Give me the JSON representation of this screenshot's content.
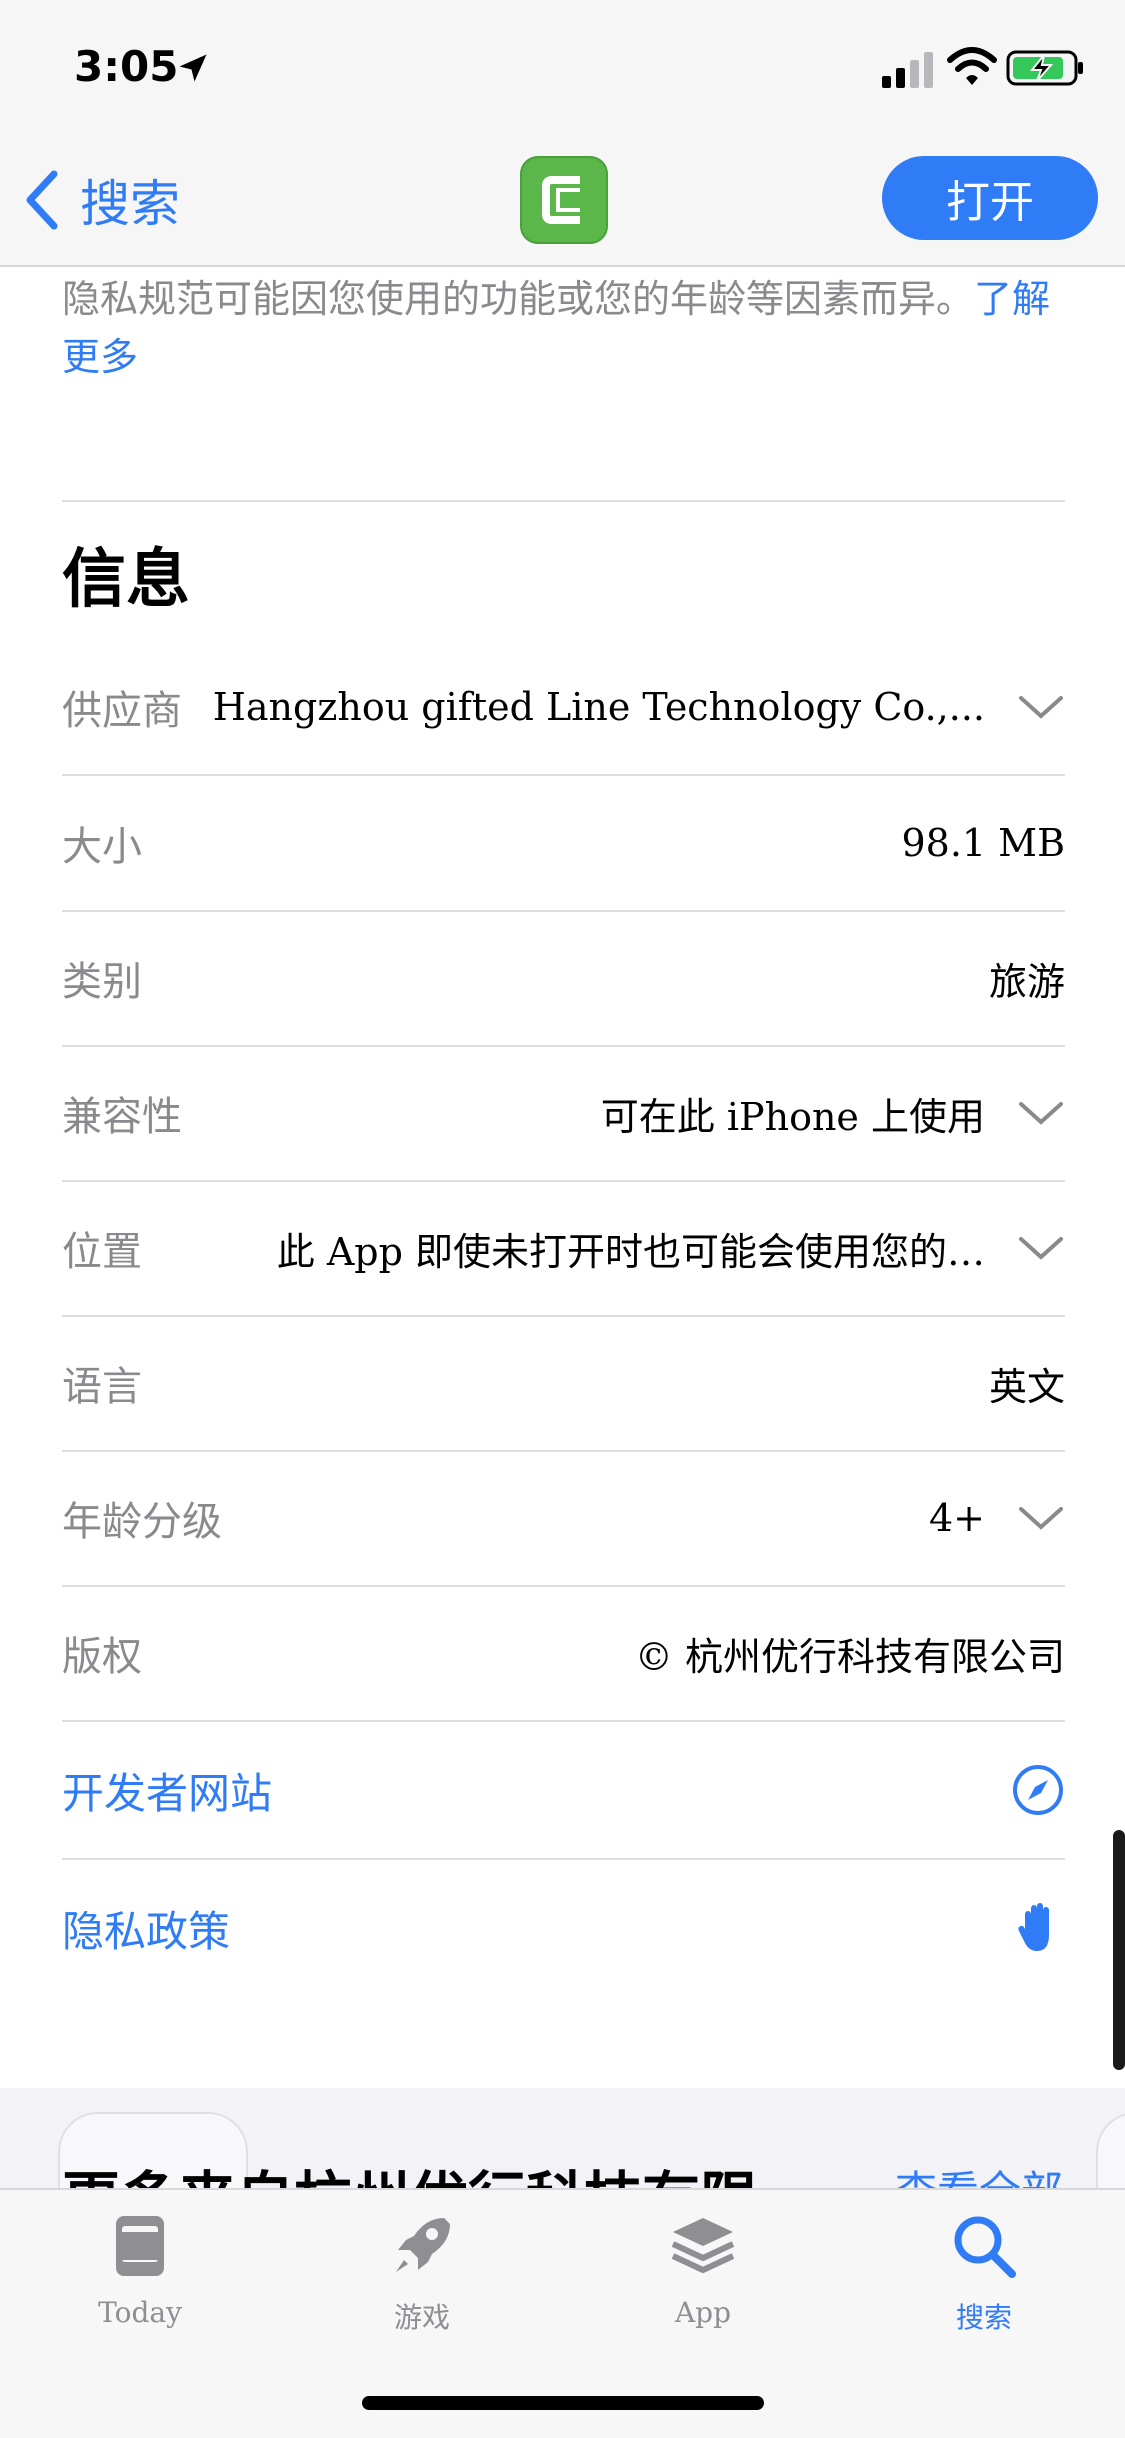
{
  "status": {
    "time": "3:05"
  },
  "nav": {
    "back_label": "搜索",
    "open_label": "打开"
  },
  "privacy_note": {
    "text": "隐私规范可能因您使用的功能或您的年龄等因素而异。",
    "link": "了解更多"
  },
  "info": {
    "title": "信息",
    "rows": [
      {
        "label": "供应商",
        "value": "Hangzhou gifted Line Technology Co.,...",
        "expandable": true
      },
      {
        "label": "大小",
        "value": "98.1 MB",
        "expandable": false
      },
      {
        "label": "类别",
        "value": "旅游",
        "expandable": false
      },
      {
        "label": "兼容性",
        "value": "可在此 iPhone 上使用",
        "expandable": true
      },
      {
        "label": "位置",
        "value": "此 App 即使未打开时也可能会使用您的…",
        "expandable": true
      },
      {
        "label": "语言",
        "value": "英文",
        "expandable": false
      },
      {
        "label": "年龄分级",
        "value": "4+",
        "expandable": true
      },
      {
        "label": "版权",
        "value": "© 杭州优行科技有限公司",
        "expandable": false
      }
    ],
    "links": [
      {
        "label": "开发者网站",
        "icon": "compass-icon"
      },
      {
        "label": "隐私政策",
        "icon": "hand-icon"
      }
    ]
  },
  "more": {
    "title": "更多来自杭州优行科技有限",
    "see_all": "查看全部"
  },
  "tabs": [
    {
      "label": "Today",
      "icon": "today-icon",
      "active": false
    },
    {
      "label": "游戏",
      "icon": "rocket-icon",
      "active": false
    },
    {
      "label": "App",
      "icon": "layers-icon",
      "active": false
    },
    {
      "label": "搜索",
      "icon": "search-icon",
      "active": true
    }
  ],
  "colors": {
    "accent": "#2f7cf6",
    "app_icon": "#5cb74a",
    "secondary_text": "#8a8a8e"
  }
}
